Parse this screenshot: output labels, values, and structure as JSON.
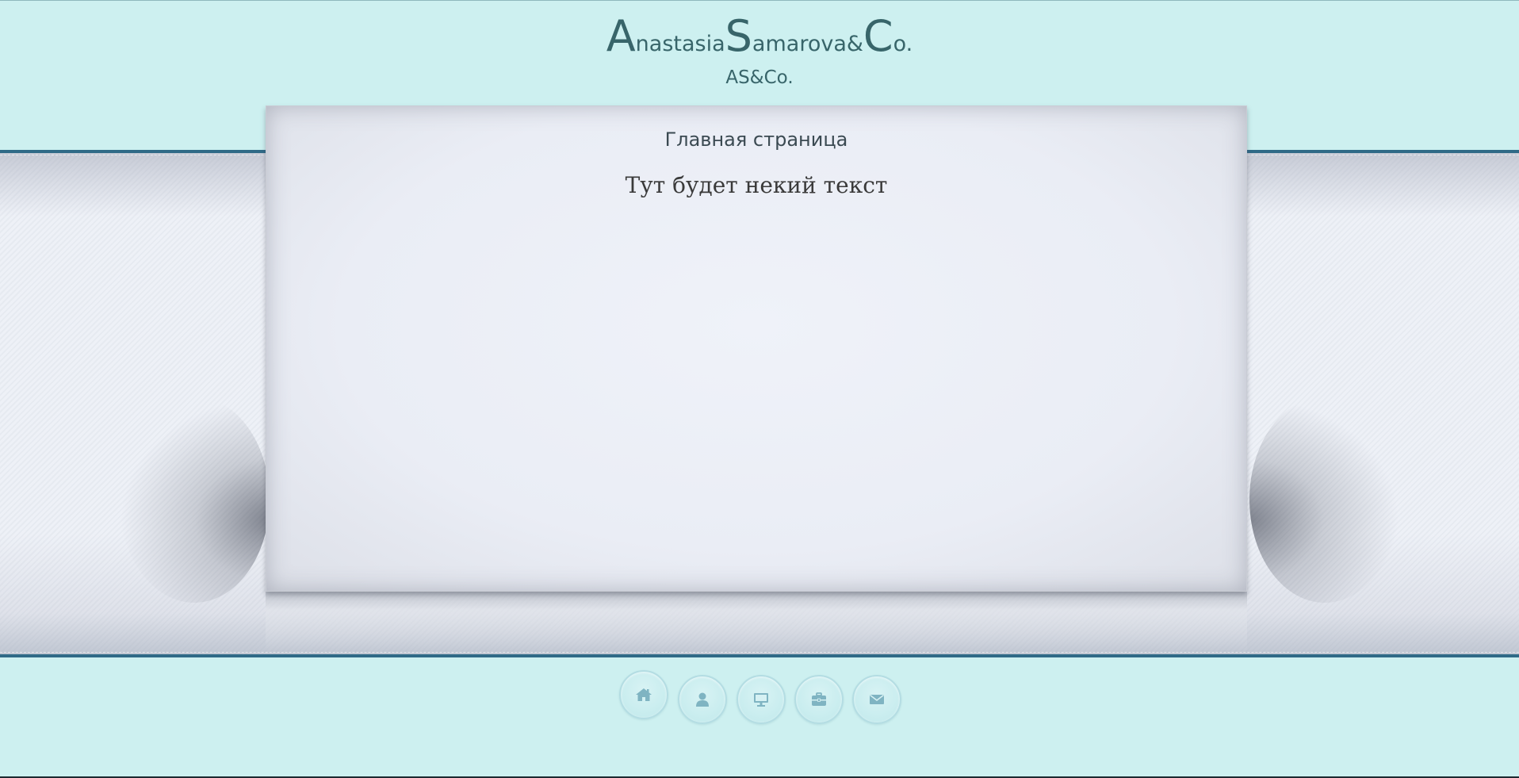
{
  "header": {
    "logo": {
      "part1_cap": "A",
      "part1_rest": "nastasia",
      "part2_cap": "S",
      "part2_rest": "amarova&",
      "part3_cap": "C",
      "part3_rest": "o."
    },
    "subtitle": "AS&Co."
  },
  "main": {
    "page_title": "Главная страница",
    "body_text": "Тут будет некий текст"
  },
  "nav": {
    "items": [
      {
        "icon": "home-icon"
      },
      {
        "icon": "user-icon"
      },
      {
        "icon": "monitor-icon"
      },
      {
        "icon": "briefcase-icon"
      },
      {
        "icon": "mail-icon"
      }
    ]
  },
  "colors": {
    "page_background": "#cdf0f0",
    "band_border": "#2f6a87",
    "logo_text": "#38656a",
    "icon_color": "#7fb4c2"
  }
}
